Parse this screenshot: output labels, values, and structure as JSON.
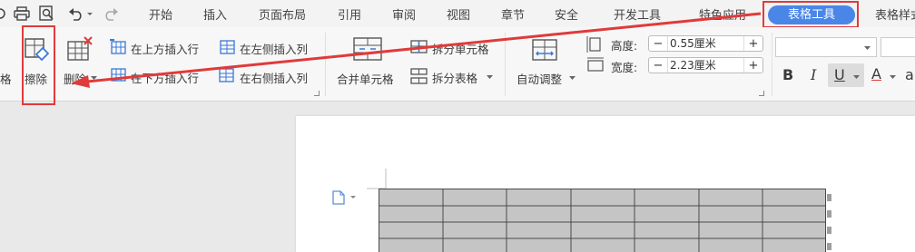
{
  "tabs": [
    "开始",
    "插入",
    "页面布局",
    "引用",
    "审阅",
    "视图",
    "章节",
    "安全",
    "开发工具",
    "特色应用",
    "表格工具",
    "表格样式"
  ],
  "active_tab": "表格工具",
  "ribbon": {
    "partial_left_label": "格",
    "erase_label": "擦除",
    "delete_label": "删除",
    "insert_above": "在上方插入行",
    "insert_below": "在下方插入行",
    "insert_left": "在左侧插入列",
    "insert_right": "在右侧插入列",
    "merge_cells": "合并单元格",
    "split_cells": "拆分单元格",
    "split_table": "拆分表格",
    "auto_fit": "自动调整",
    "height_label": "高度:",
    "height_value": "0.55厘米",
    "width_label": "宽度:",
    "width_value": "2.23厘米",
    "bold": "B",
    "italic": "I",
    "underline": "U",
    "font_color": "A",
    "highlight": "a"
  },
  "document": {
    "table_rows": 4,
    "table_cols": 7
  },
  "colors": {
    "accent": "#4a86e8",
    "annotation_red": "#e03a3a",
    "table_cell": "#c5c5c5"
  }
}
